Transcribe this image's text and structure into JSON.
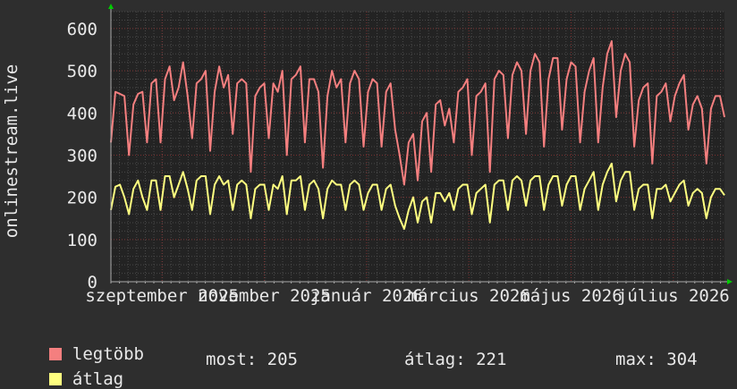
{
  "chart_data": {
    "type": "line",
    "ylabel": "onlinestream.live",
    "ylim": [
      0,
      640
    ],
    "yticks": [
      0,
      100,
      200,
      300,
      400,
      500,
      600
    ],
    "xticks": [
      "szeptember 2025",
      "november 2025",
      "január 2026",
      "március 2026",
      "május 2026",
      "július 2026"
    ],
    "grid": true,
    "series": [
      {
        "name": "legtöbb",
        "color": "#f47f7f",
        "values": [
          330,
          450,
          445,
          440,
          300,
          420,
          445,
          450,
          330,
          470,
          480,
          330,
          480,
          510,
          430,
          460,
          520,
          440,
          340,
          470,
          480,
          500,
          310,
          450,
          510,
          460,
          490,
          350,
          470,
          480,
          470,
          260,
          440,
          460,
          470,
          340,
          470,
          450,
          500,
          300,
          480,
          490,
          510,
          330,
          480,
          480,
          450,
          270,
          440,
          500,
          460,
          480,
          330,
          470,
          500,
          480,
          320,
          450,
          480,
          470,
          320,
          450,
          470,
          360,
          300,
          230,
          330,
          350,
          240,
          380,
          400,
          260,
          420,
          430,
          370,
          410,
          330,
          450,
          460,
          480,
          300,
          440,
          450,
          470,
          260,
          480,
          500,
          490,
          340,
          490,
          520,
          500,
          350,
          500,
          540,
          520,
          320,
          480,
          530,
          530,
          360,
          480,
          520,
          510,
          330,
          450,
          500,
          530,
          330,
          460,
          540,
          570,
          390,
          500,
          540,
          520,
          320,
          430,
          460,
          470,
          280,
          440,
          450,
          470,
          380,
          440,
          470,
          490,
          360,
          420,
          440,
          410,
          280,
          410,
          440,
          440,
          390
        ]
      },
      {
        "name": "átlag",
        "color": "#ffff80",
        "values": [
          170,
          225,
          230,
          200,
          160,
          220,
          240,
          200,
          170,
          240,
          240,
          170,
          250,
          250,
          200,
          230,
          260,
          220,
          170,
          240,
          250,
          250,
          160,
          230,
          250,
          230,
          240,
          170,
          230,
          240,
          230,
          150,
          220,
          230,
          230,
          170,
          230,
          220,
          250,
          160,
          240,
          240,
          250,
          170,
          230,
          240,
          220,
          150,
          220,
          240,
          230,
          230,
          170,
          230,
          240,
          230,
          170,
          210,
          230,
          230,
          170,
          220,
          230,
          180,
          150,
          125,
          170,
          200,
          140,
          190,
          200,
          140,
          210,
          210,
          190,
          210,
          170,
          220,
          230,
          230,
          160,
          210,
          220,
          230,
          140,
          230,
          240,
          240,
          170,
          240,
          250,
          240,
          180,
          240,
          250,
          250,
          170,
          230,
          250,
          250,
          180,
          230,
          250,
          250,
          170,
          220,
          240,
          260,
          170,
          230,
          260,
          280,
          190,
          240,
          260,
          260,
          170,
          220,
          230,
          230,
          150,
          220,
          220,
          230,
          190,
          210,
          230,
          240,
          180,
          210,
          220,
          210,
          150,
          200,
          220,
          220,
          205
        ]
      }
    ]
  },
  "legend": {
    "max_label": "legtöbb",
    "avg_label": "átlag",
    "now": "most: 205",
    "avg": "átlag: 221",
    "max": "max: 304"
  },
  "colors": {
    "background": "#2e2e2e",
    "plot_background": "#232323",
    "grid_minor": "#4a4a4a",
    "grid_major": "#7a3030",
    "axis_arrow": "#00cc00"
  }
}
